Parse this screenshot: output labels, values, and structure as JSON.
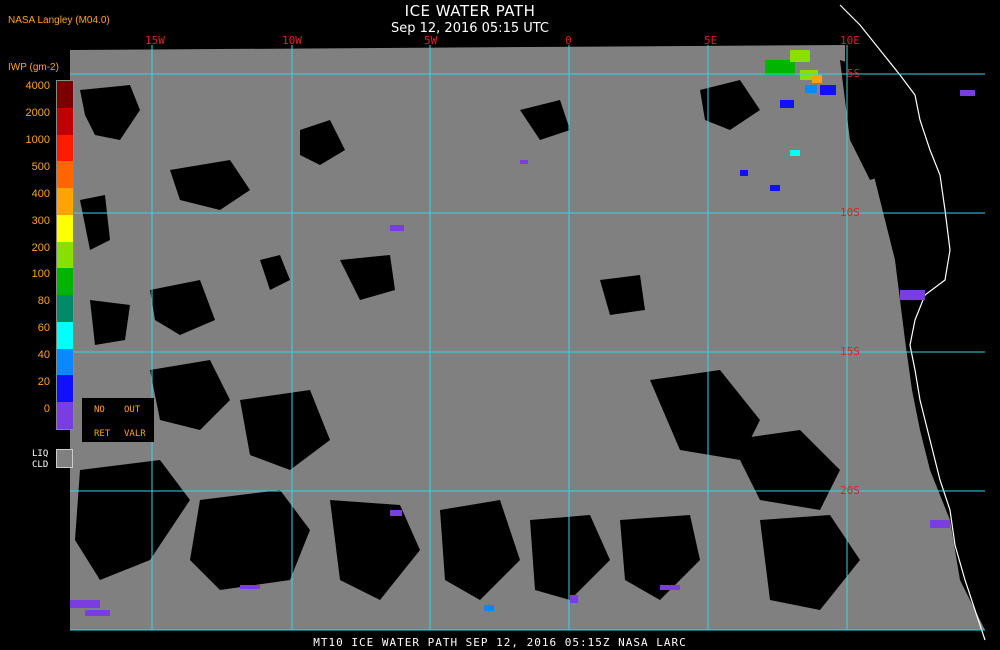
{
  "header": {
    "credit": "NASA Langley (M04.0)",
    "title": "ICE WATER PATH",
    "subtitle": "Sep 12, 2016 05:15 UTC"
  },
  "colorbar": {
    "title": "IWP (gm-2)",
    "levels": [
      {
        "label": "4000",
        "color": "#7a0000"
      },
      {
        "label": "2000",
        "color": "#c00000"
      },
      {
        "label": "1000",
        "color": "#ff1a00"
      },
      {
        "label": "500",
        "color": "#ff6600"
      },
      {
        "label": "400",
        "color": "#ffa300"
      },
      {
        "label": "300",
        "color": "#ffff00"
      },
      {
        "label": "200",
        "color": "#88e000"
      },
      {
        "label": "100",
        "color": "#00b400"
      },
      {
        "label": "80",
        "color": "#008a6a"
      },
      {
        "label": "60",
        "color": "#00ffff"
      },
      {
        "label": "40",
        "color": "#0a88ff"
      },
      {
        "label": "20",
        "color": "#1010ff"
      },
      {
        "label": "0",
        "color": "#7a3ee0"
      }
    ]
  },
  "legend": {
    "no": "NO",
    "out": "OUT",
    "ret": "RET",
    "valr": "VALR",
    "liq_line1": "LIQ",
    "liq_line2": "CLD"
  },
  "map": {
    "longitudes": [
      "15W",
      "10W",
      "5W",
      "0",
      "5E",
      "10E"
    ],
    "latitudes": [
      "5S",
      "10S",
      "15S",
      "20S"
    ],
    "grid_color": "#33d6e6",
    "cloud_color": "#808080",
    "clear_color": "#000000",
    "coast_color": "#ffffff"
  },
  "footer": {
    "caption": "MT10  ICE WATER PATH   SEP 12, 2016 05:15Z   NASA LARC"
  }
}
